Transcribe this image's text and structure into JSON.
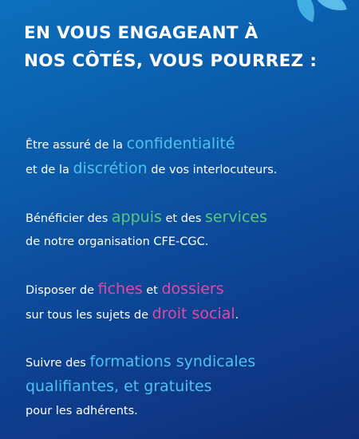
{
  "heading": {
    "line1": "EN VOUS ENGAGEANT À",
    "line2": "NOS CÔTÉS, VOUS POURREZ :"
  },
  "items": [
    {
      "a": "Être assuré de la ",
      "b": "confidentialité",
      "c": "et de la ",
      "d": "discrétion",
      "e": " de vos interlocuteurs."
    },
    {
      "a": "Bénéficier des ",
      "b": "appuis",
      "c": " et des ",
      "d": "services",
      "e": "de notre organisation CFE-CGC."
    },
    {
      "a": "Disposer de ",
      "b": "fiches",
      "c": " et ",
      "d": "dossiers",
      "e": "sur tous les sujets de ",
      "f": "droit social",
      "g": "."
    },
    {
      "a": "Suivre des ",
      "b": "formations syndicales",
      "c": "qualifiantes, et gratuites",
      "d": "pour les adhérents."
    }
  ],
  "colors": {
    "background": "#0b5aa8",
    "accent_blue": "#4fc1ef",
    "accent_green": "#5bc488",
    "accent_pink": "#e04a9f"
  }
}
